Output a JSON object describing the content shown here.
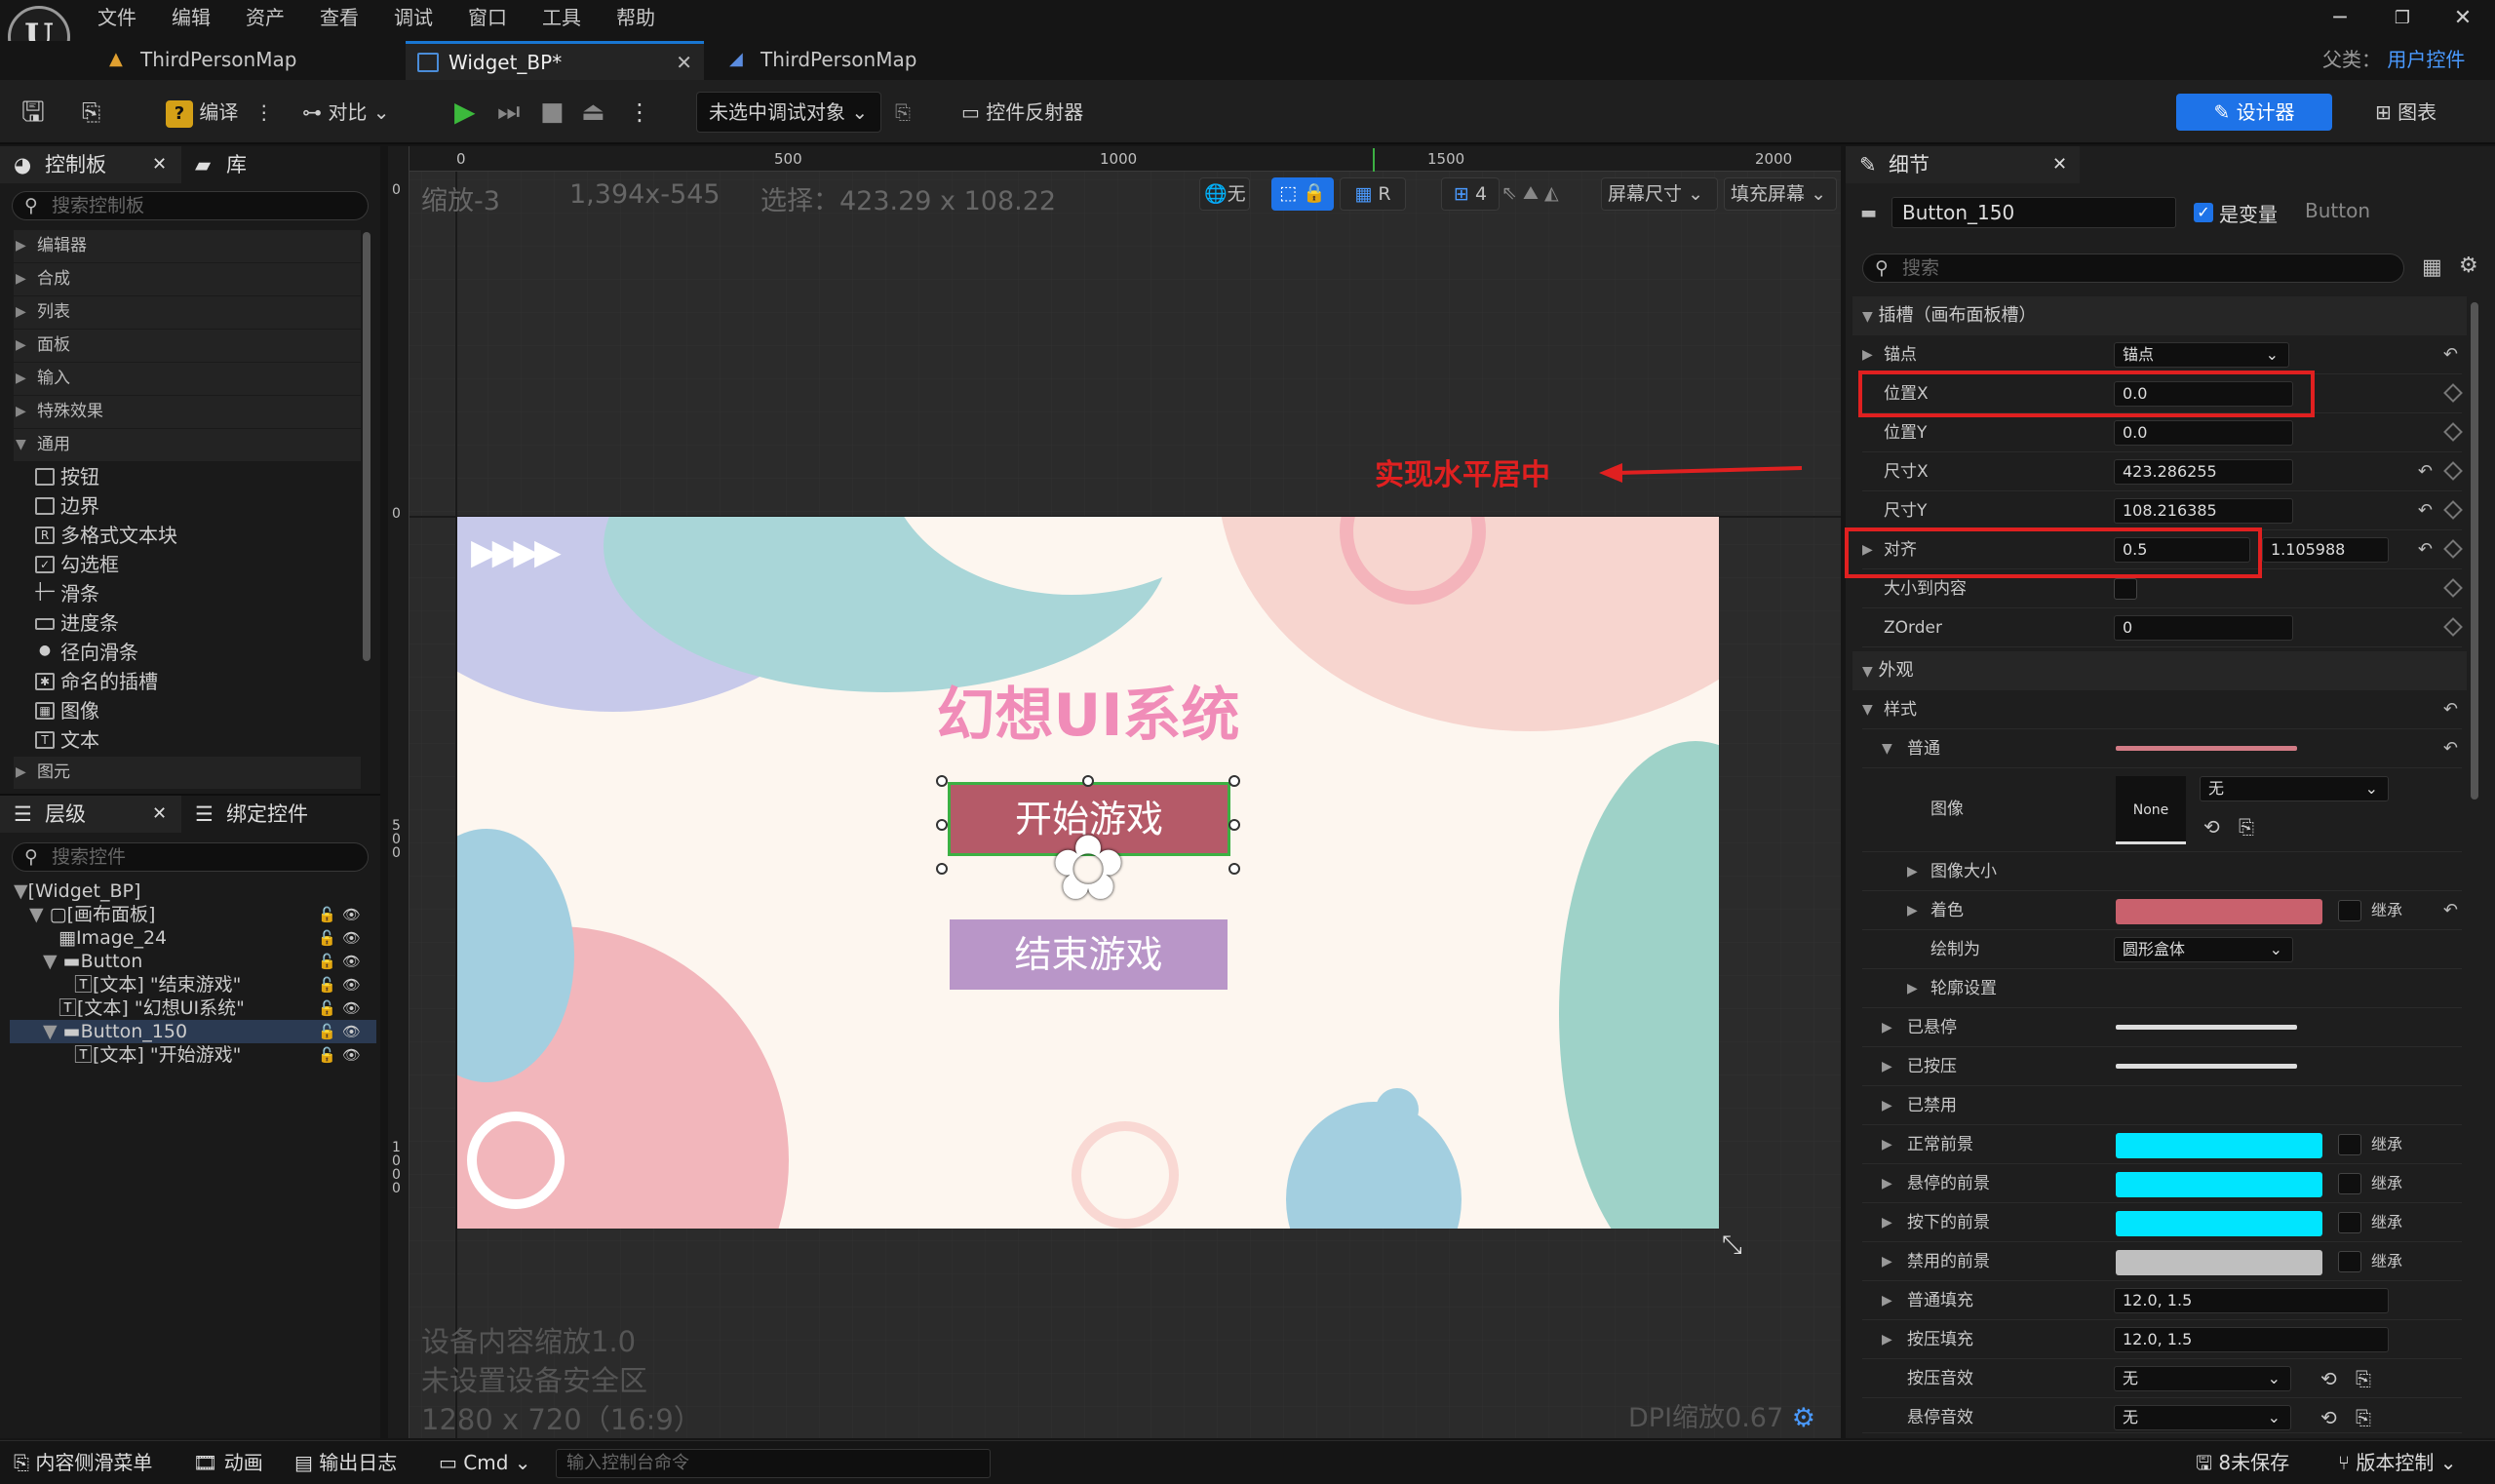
{
  "menu": [
    "文件",
    "编辑",
    "资产",
    "查看",
    "调试",
    "窗口",
    "工具",
    "帮助"
  ],
  "tabs": [
    {
      "label": "ThirdPersonMap"
    },
    {
      "label": "Widget_BP*"
    },
    {
      "label": "ThirdPersonMap"
    }
  ],
  "parent_class": {
    "label": "父类：",
    "value": "用户控件"
  },
  "toolbar": {
    "compile": "编译",
    "diff": "对比",
    "debug_select": "未选中调试对象",
    "reflector": "控件反射器",
    "designer": "设计器",
    "graph": "图表"
  },
  "palette": {
    "tab": "控制板",
    "library_tab": "库",
    "search_placeholder": "搜索控制板",
    "categories": [
      "编辑器",
      "合成",
      "列表",
      "面板",
      "输入",
      "特殊效果",
      "通用"
    ],
    "common_items": [
      "按钮",
      "边界",
      "多格式文本块",
      "勾选框",
      "滑条",
      "进度条",
      "径向滑条",
      "命名的插槽",
      "图像",
      "文本"
    ],
    "last_category": "图元"
  },
  "hierarchy": {
    "tab": "层级",
    "bind_tab": "绑定控件",
    "search_placeholder": "搜索控件",
    "rows": [
      "[Widget_BP]",
      "[画布面板]",
      "Image_24",
      "Button",
      "[文本] \"结束游戏\"",
      "[文本] \"幻想UI系统\"",
      "Button_150",
      "[文本] \"开始游戏\""
    ]
  },
  "viewport": {
    "zoom": "缩放-3",
    "resolution": "1,394x-545",
    "selection": "选择：423.29 x 108.22",
    "ruler_top": [
      "0",
      "500",
      "1000",
      "1500",
      "2000"
    ],
    "ruler_left": [
      "0",
      "0",
      "500",
      "1000"
    ],
    "none_label": "无",
    "r_label": "R",
    "grid_count": "4",
    "screen_size": "屏幕尺寸",
    "fill_screen": "填充屏幕",
    "annotation": "实现水平居中",
    "device_scale": "设备内容缩放1.0",
    "safe_zone": "未设置设备安全区",
    "canvas_size": "1280 x 720（16:9）",
    "dpi": "DPI缩放0.67"
  },
  "canvas": {
    "title": "幻想UI系统",
    "start_button": "开始游戏",
    "quit_button": "结束游戏",
    "colors": {
      "start": "#b55a68",
      "quit": "#b996c8",
      "title": "#f08cb8"
    }
  },
  "details": {
    "tab": "细节",
    "name": "Button_150",
    "is_variable": "是变量",
    "class": "Button",
    "search_placeholder": "搜索",
    "slot_section": "插槽（画布面板槽）",
    "rows": [
      {
        "label": "锚点",
        "value": "锚点"
      },
      {
        "label": "位置X",
        "value": "0.0"
      },
      {
        "label": "位置Y",
        "value": "0.0"
      },
      {
        "label": "尺寸X",
        "value": "423.286255"
      },
      {
        "label": "尺寸Y",
        "value": "108.216385"
      },
      {
        "label": "对齐",
        "value": "0.5",
        "value2": "1.105988"
      },
      {
        "label": "大小到内容",
        "value": ""
      },
      {
        "label": "ZOrder",
        "value": "0"
      }
    ],
    "appearance": "外观",
    "style": "样式",
    "normal": "普通",
    "image": "图像",
    "image_none": "None",
    "image_dropdown": "无",
    "image_size": "图像大小",
    "tint": "着色",
    "draw_as": "绘制为",
    "draw_as_value": "圆形盒体",
    "outline": "轮廓设置",
    "hovered": "已悬停",
    "pressed": "已按压",
    "disabled": "已禁用",
    "normal_fg": "正常前景",
    "hover_fg": "悬停的前景",
    "pressed_fg": "按下的前景",
    "disabled_fg": "禁用的前景",
    "normal_padding": "普通填充",
    "normal_padding_value": "12.0, 1.5",
    "pressed_padding": "按压填充",
    "pressed_padding_value": "12.0, 1.5",
    "press_sound": "按压音效",
    "press_sound_value": "无",
    "hover_sound": "悬停音效",
    "hover_sound_value": "无",
    "inherit": "继承",
    "colors": {
      "tint": "#c9616d",
      "fg": "#00e5ff",
      "disabled_fg": "#bfbfbf"
    }
  },
  "statusbar": {
    "content_drawer": "内容侧滑菜单",
    "animation": "动画",
    "output_log": "输出日志",
    "cmd": "Cmd",
    "console_placeholder": "输入控制台命令",
    "unsaved": "8未保存",
    "source_control": "版本控制"
  }
}
